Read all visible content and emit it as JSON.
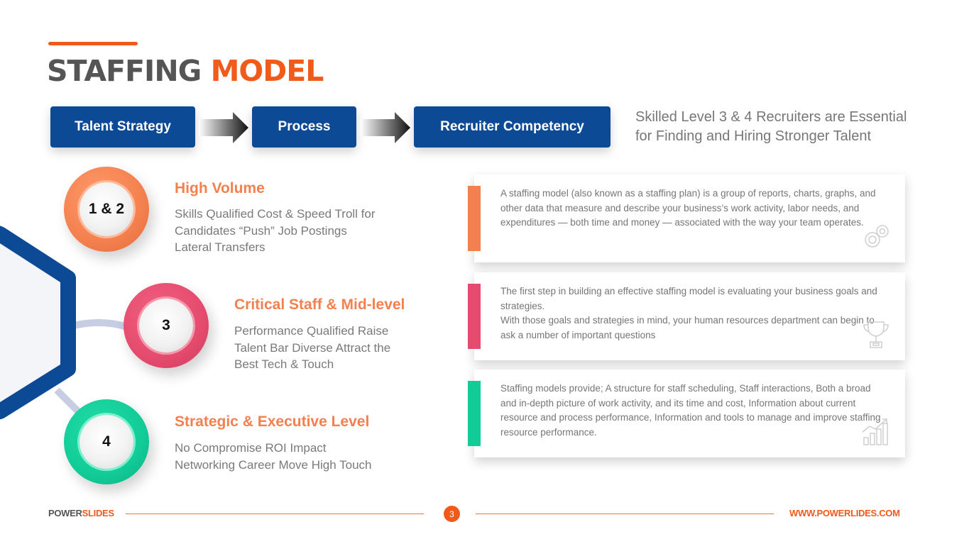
{
  "header": {
    "title_part1": "STAFFING",
    "title_part2": "MODEL"
  },
  "flow": {
    "steps": [
      {
        "label": "Talent Strategy"
      },
      {
        "label": "Process"
      },
      {
        "label": "Recruiter Competency"
      }
    ],
    "tagline": "Skilled Level 3 & 4 Recruiters are Essential for Finding and Hiring Stronger Talent"
  },
  "levels": [
    {
      "badge": "1 & 2",
      "title": "High Volume",
      "description": "Skills Qualified Cost & Speed Troll for\nCandidates “Push” Job Postings\nLateral Transfers",
      "color": "#f4804f"
    },
    {
      "badge": "3",
      "title": "Critical Staff & Mid-level",
      "description": "Performance Qualified Raise\nTalent Bar Diverse Attract the\nBest Tech & Touch",
      "color": "#e54b6e"
    },
    {
      "badge": "4",
      "title": "Strategic & Executive Level",
      "description": "No Compromise ROI Impact\nNetworking Career Move High Touch",
      "color": "#12cc98"
    }
  ],
  "cards": [
    {
      "text": "A staffing model (also known as a staffing plan) is a group of reports, charts, graphs, and other data that measure and describe your business’s work activity, labor needs, and expenditures — both time and money — associated with the way your team operates.",
      "icon": "gears-icon",
      "color": "#f4804f"
    },
    {
      "text": "The first step in building an effective staffing model is evaluating your business goals and strategies.\nWith those goals and strategies in mind, your human resources department can begin to ask a number of important questions",
      "icon": "trophy-icon",
      "color": "#e54b6e"
    },
    {
      "text": "Staffing models provide; A structure for staff scheduling, Staff interactions, Both a broad and in-depth picture of work activity, and its time and cost, Information about current resource and process performance, Information and tools to manage and improve staffing resource performance.",
      "icon": "growth-chart-icon",
      "color": "#12cc98"
    }
  ],
  "footer": {
    "brand_part1": "POWER",
    "brand_part2": "SLIDES",
    "page_number": "3",
    "url": "WWW.POWERLIDES.COM"
  },
  "colors": {
    "accent": "#f05a1a",
    "primary_blue": "#0d4a96",
    "title_gray": "#555555"
  }
}
